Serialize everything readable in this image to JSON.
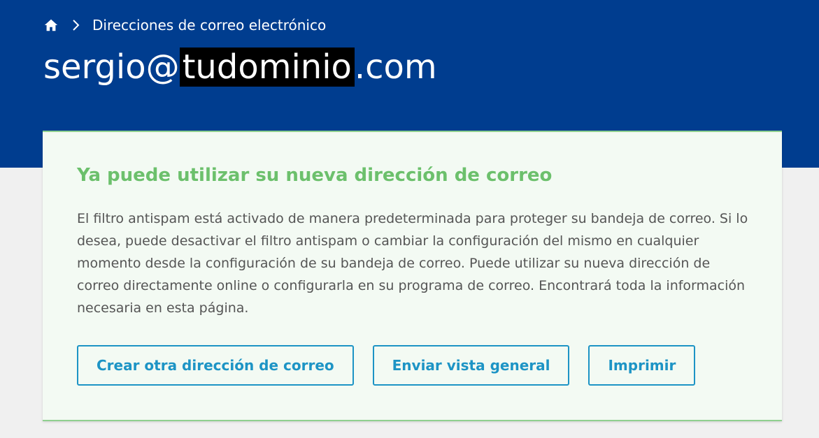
{
  "breadcrumb": {
    "home_icon": "home-icon",
    "separator_icon": "chevron-right-icon",
    "current_label": "Direcciones de correo electrónico"
  },
  "title": {
    "user": "sergio@",
    "domain_redacted": "tudominio",
    "tld": ".com"
  },
  "card": {
    "heading": "Ya puede utilizar su nueva dirección de correo",
    "body": "El filtro antispam está activado de manera predeterminada para proteger su bandeja de correo. Si lo desea, puede desactivar el filtro antispam o cambiar la configuración del mismo en cualquier momento desde la configuración de su bandeja de correo. Puede utilizar su nueva dirección de correo directamente online o configurarla en su programa de correo. Encontrará toda la información necesaria en esta página.",
    "buttons": {
      "create_another": "Crear otra dirección de correo",
      "send_overview": "Enviar vista general",
      "print": "Imprimir"
    }
  },
  "colors": {
    "header_background": "#003d8f",
    "page_background": "#f0f0f0",
    "card_background": "#f3faf3",
    "success_green": "#6cc06c",
    "button_blue": "#1d94c5"
  }
}
